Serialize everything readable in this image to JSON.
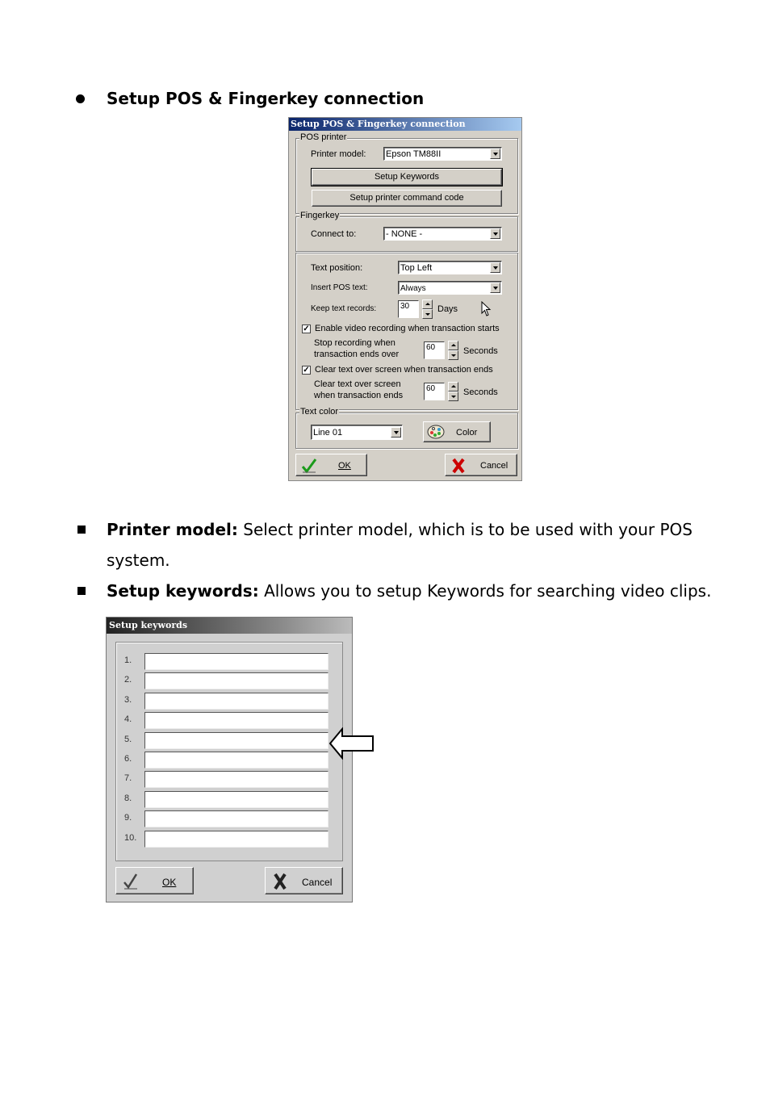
{
  "section1": {
    "heading": "Setup POS & Fingerkey connection"
  },
  "pos_dialog": {
    "title": "Setup POS & Fingerkey connection",
    "pos_printer_group": "POS printer",
    "printer_model_label": "Printer model:",
    "printer_model_value": "Epson TM88II",
    "setup_keywords_button": "Setup Keywords",
    "setup_command_button": "Setup printer command code",
    "fingerkey_group": "Fingerkey",
    "connect_to_label": "Connect to:",
    "connect_to_value": "- NONE -",
    "text_position_label": "Text position:",
    "text_position_value": "Top Left",
    "insert_pos_label": "Insert POS text:",
    "insert_pos_value": "Always",
    "keep_records_label": "Keep text records:",
    "keep_records_value": "30",
    "keep_records_unit": "Days",
    "enable_video_label": "Enable video recording when transaction starts",
    "enable_video_checked": true,
    "stop_recording_label_1": "Stop recording when",
    "stop_recording_label_2": "transaction ends over",
    "stop_recording_value": "60",
    "stop_recording_unit": "Seconds",
    "clear_text_label": "Clear text over screen when transaction ends",
    "clear_text_checked": true,
    "clear_text_sub_1": "Clear text over screen",
    "clear_text_sub_2": "when transaction ends",
    "clear_text_value": "60",
    "clear_text_unit": "Seconds",
    "text_color_group": "Text color",
    "text_color_line_value": "Line 01",
    "color_button": "Color",
    "ok_button": "OK",
    "cancel_button": "Cancel"
  },
  "paragraphs": {
    "printer_model_term": "Printer model:",
    "printer_model_text_1": " Select printer model, which is to be used with your POS",
    "printer_model_text_2": "system.",
    "setup_keywords_term": "Setup keywords:",
    "setup_keywords_text": " Allows you to setup Keywords for searching video clips."
  },
  "keywords_dialog": {
    "title": "Setup keywords",
    "rows": [
      "1.",
      "2.",
      "3.",
      "4.",
      "5.",
      "6.",
      "7.",
      "8.",
      "9.",
      "10."
    ],
    "values": [
      "",
      "",
      "",
      "",
      "",
      "",
      "",
      "",
      "",
      ""
    ],
    "ok_button": "OK",
    "cancel_button": "Cancel"
  }
}
